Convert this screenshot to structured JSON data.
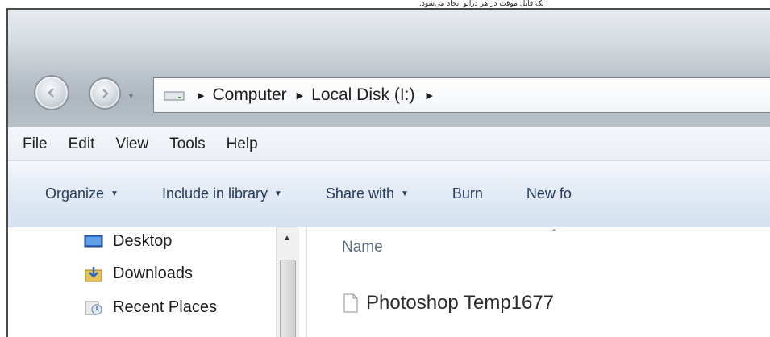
{
  "caption": "یک فایل موقت در هر درایو ایجاد می‌شود.",
  "address": {
    "crumbs": [
      "Computer",
      "Local Disk (I:)"
    ]
  },
  "menu": [
    "File",
    "Edit",
    "View",
    "Tools",
    "Help"
  ],
  "toolbar": {
    "organize": "Organize",
    "include": "Include in library",
    "share": "Share with",
    "burn": "Burn",
    "new_folder": "New fo"
  },
  "nav": {
    "items": [
      {
        "label": "Desktop",
        "icon": "desktop-icon"
      },
      {
        "label": "Downloads",
        "icon": "downloads-icon"
      },
      {
        "label": "Recent Places",
        "icon": "recent-places-icon"
      }
    ]
  },
  "content": {
    "column_header": "Name",
    "file_name": "Photoshop Temp1677",
    "file_icon": "file-icon"
  }
}
